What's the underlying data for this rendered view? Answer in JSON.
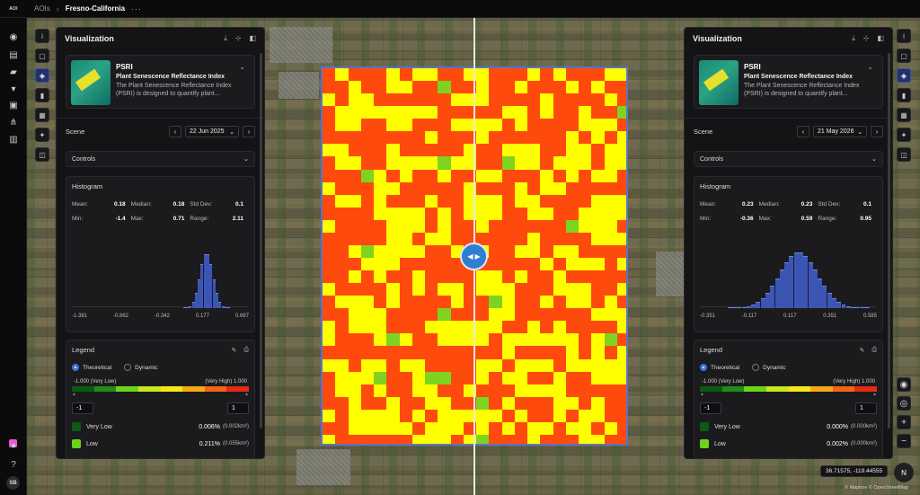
{
  "topbar": {
    "brand": "AOI",
    "root": "AOIs",
    "current": "Fresno-California",
    "more": "···"
  },
  "rail": {
    "avatar": "SB"
  },
  "panels": {
    "left": {
      "title": "Visualization",
      "index_abbr": "PSRI",
      "index_name": "Plant Senescence Reflectance Index",
      "index_desc": "The Plant Senescence Reflectance Index (PSRI) is designed to quantify plant...",
      "scene_label": "Scene",
      "scene_date": "22 Jun 2025",
      "controls_label": "Controls",
      "hist_title": "Histogram",
      "stats": [
        {
          "k": "Mean:",
          "v": "0.18"
        },
        {
          "k": "Median:",
          "v": "0.18"
        },
        {
          "k": "Std Dev:",
          "v": "0.1"
        },
        {
          "k": "Min:",
          "v": "-1.4"
        },
        {
          "k": "Max:",
          "v": "0.71"
        },
        {
          "k": "Range:",
          "v": "2.11"
        }
      ],
      "ticks": [
        "-1.381",
        "-0.862",
        "-0.342",
        "0.177",
        "0.697"
      ],
      "legend_title": "Legend",
      "radio_theoretical": "Theoretical",
      "radio_dynamic": "Dynamic",
      "ramp_low": "-1.000 (Very Low)",
      "ramp_high": "(Very High) 1.000",
      "min_input": "-1",
      "max_input": "1",
      "classes": [
        {
          "name": "Very Low",
          "pct": "0.006%",
          "area": "(0.002km²)",
          "color": "#0f5a14"
        },
        {
          "name": "Low",
          "pct": "0.211%",
          "area": "(0.055km²)",
          "color": "#6bd41a"
        }
      ]
    },
    "right": {
      "title": "Visualization",
      "index_abbr": "PSRI",
      "index_name": "Plant Senescence Reflectance Index",
      "index_desc": "The Plant Senescence Reflectance Index (PSRI) is designed to quantify plant...",
      "scene_label": "Scene",
      "scene_date": "21 May 2026",
      "controls_label": "Controls",
      "hist_title": "Histogram",
      "stats": [
        {
          "k": "Mean:",
          "v": "0.23"
        },
        {
          "k": "Median:",
          "v": "0.23"
        },
        {
          "k": "Std Dev:",
          "v": "0.1"
        },
        {
          "k": "Min:",
          "v": "-0.36"
        },
        {
          "k": "Max:",
          "v": "0.59"
        },
        {
          "k": "Range:",
          "v": "0.95"
        }
      ],
      "ticks": [
        "-0.351",
        "-0.117",
        "0.117",
        "0.351",
        "0.585"
      ],
      "legend_title": "Legend",
      "radio_theoretical": "Theoretical",
      "radio_dynamic": "Dynamic",
      "ramp_low": "-1.000 (Very Low)",
      "ramp_high": "(Very High) 1.000",
      "min_input": "-1",
      "max_input": "1",
      "classes": [
        {
          "name": "Very Low",
          "pct": "0.000%",
          "area": "(0.000km²)",
          "color": "#0f5a14"
        },
        {
          "name": "Low",
          "pct": "0.002%",
          "area": "(0.000km²)",
          "color": "#6bd41a"
        }
      ]
    }
  },
  "ramp_colors": [
    "#0b5a10",
    "#1f8c18",
    "#6bd41a",
    "#c8e61a",
    "#f5e816",
    "#f5a814",
    "#f26414",
    "#e52a12"
  ],
  "map": {
    "coords": "36.71575, -119.44555",
    "attribution": "© Mapbox © OpenStreetMap",
    "compass": "N"
  }
}
